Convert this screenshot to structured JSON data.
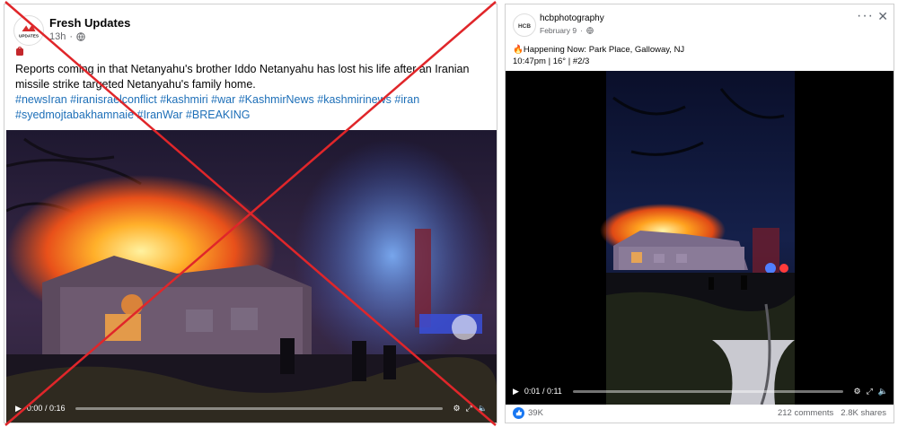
{
  "left_post": {
    "page_name": "Fresh Updates",
    "timestamp": "13h",
    "avatar_label": "UPDATES",
    "body": "Reports coming in that Netanyahu's brother Iddo Netanyahu has lost his life after an Iranian missile strike targeted Netanyahu's family home.",
    "hashtags": "#newsIran #iranisraelconflict #kashmiri #war #KashmirNews #kashmirinews #iran #syedmojtabakhamnaie #IranWar #BREAKING",
    "video_time": "0:00 / 0:16",
    "cross_color": "#e0262a"
  },
  "right_post": {
    "page_name": "hcbphotography",
    "avatar_label": "HCB",
    "timestamp": "February 9",
    "line1": "🔥Happening Now: Park Place, Galloway, NJ",
    "line2": "10:47pm | 16° | #2/3",
    "video_time": "0:01 / 0:11",
    "reactions": "39K",
    "comments": "212 comments",
    "shares": "2.8K shares"
  }
}
